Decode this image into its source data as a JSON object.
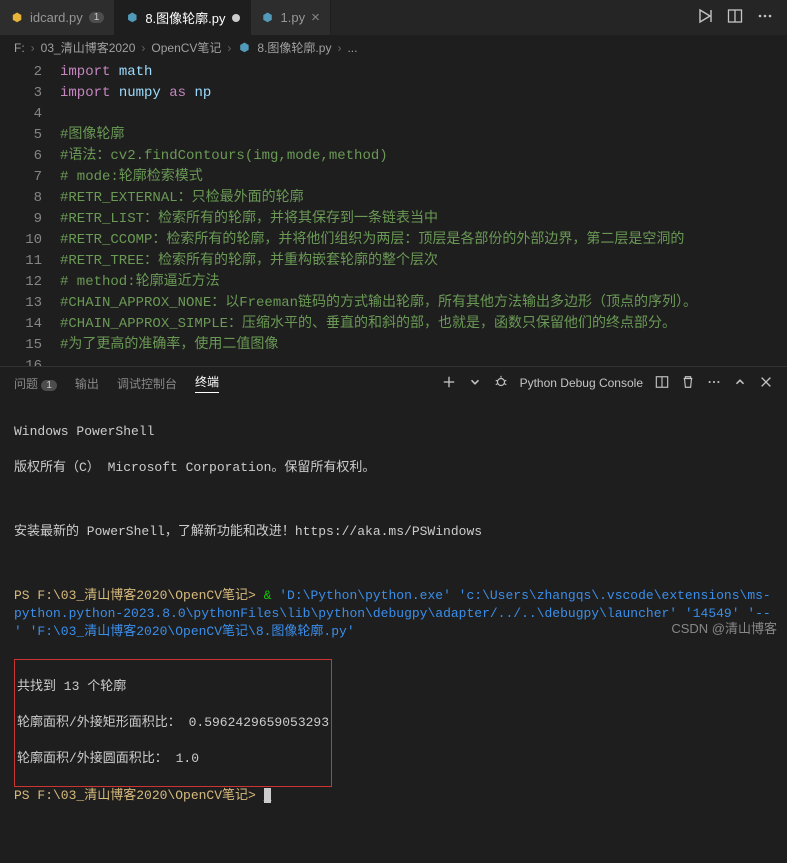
{
  "tabs": {
    "t0": {
      "icon": "⬢",
      "name": "idcard.py",
      "badge": "1"
    },
    "t1": {
      "icon": "⬢",
      "name": "8.图像轮廓.py"
    },
    "t2": {
      "icon": "⬢",
      "name": "1.py"
    }
  },
  "breadcrumb": {
    "p0": "F:",
    "p1": "03_清山博客2020",
    "p2": "OpenCV笔记",
    "p3": "8.图像轮廓.py",
    "p4": "..."
  },
  "code": {
    "l2": {
      "n": "2",
      "kw1": "import ",
      "id": "math"
    },
    "l3": {
      "n": "3",
      "kw1": "import ",
      "id1": "numpy ",
      "kw2": "as ",
      "id2": "np"
    },
    "l4": {
      "n": "4",
      "t": ""
    },
    "l5": {
      "n": "5",
      "t": "#图像轮廓"
    },
    "l6": {
      "n": "6",
      "t": "#语法：cv2.findContours(img,mode,method)"
    },
    "l7": {
      "n": "7",
      "t": "# mode:轮廓检索模式"
    },
    "l8": {
      "n": "8",
      "t": "#RETR_EXTERNAL：只检最外面的轮廓"
    },
    "l9": {
      "n": "9",
      "t": "#RETR_LIST：检索所有的轮廓，并将其保存到一条链表当中"
    },
    "l10": {
      "n": "10",
      "t": "#RETR_CCOMP：检索所有的轮廓，并将他们组织为两层：顶层是各部份的外部边界，第二层是空洞的"
    },
    "l11": {
      "n": "11",
      "t": "#RETR_TREE：检索所有的轮廓，并重构嵌套轮廓的整个层次"
    },
    "l12": {
      "n": "12",
      "t": "# method:轮廓逼近方法"
    },
    "l13": {
      "n": "13",
      "t": "#CHAIN_APPROX_NONE：以Freeman链码的方式输出轮廓，所有其他方法输出多边形（顶点的序列）。"
    },
    "l14": {
      "n": "14",
      "t": "#CHAIN_APPROX_SIMPLE：压缩水平的、垂直的和斜的部，也就是，函数只保留他们的终点部分。"
    },
    "l15": {
      "n": "15",
      "t": "#为了更高的准确率，使用二值图像"
    },
    "l16": {
      "n": "16",
      "t": ""
    }
  },
  "panel": {
    "problems": "问题",
    "problems_count": "1",
    "output": "输出",
    "debug": "调试控制台",
    "terminal": "终端",
    "console_label": "Python Debug Console"
  },
  "terminal": {
    "l1": "Windows PowerShell",
    "l2": "版权所有（C） Microsoft Corporation。保留所有权利。",
    "l3": "安装最新的 PowerShell，了解新功能和改进！https://aka.ms/PSWindows",
    "prompt1": "PS F:\\03_清山博客2020\\OpenCV笔记> ",
    "cmd_amp": "& ",
    "cmd_path": "'D:\\Python\\python.exe' 'c:\\Users\\zhangqs\\.vscode\\extensions\\ms-python.python-2023.8.0\\pythonFiles\\lib\\python\\debugpy\\adapter/../..\\debugpy\\launcher' '14549' '--' 'F:\\03_清山博客2020\\OpenCV笔记\\8.图像轮廓.py'",
    "out1": "共找到 13 个轮廓",
    "out2": "轮廓面积/外接矩形面积比： 0.5962429659053293",
    "out3": "轮廓面积/外接圆面积比： 1.0",
    "prompt2": "PS F:\\03_清山博客2020\\OpenCV笔记> "
  },
  "watermark": "CSDN @清山博客"
}
